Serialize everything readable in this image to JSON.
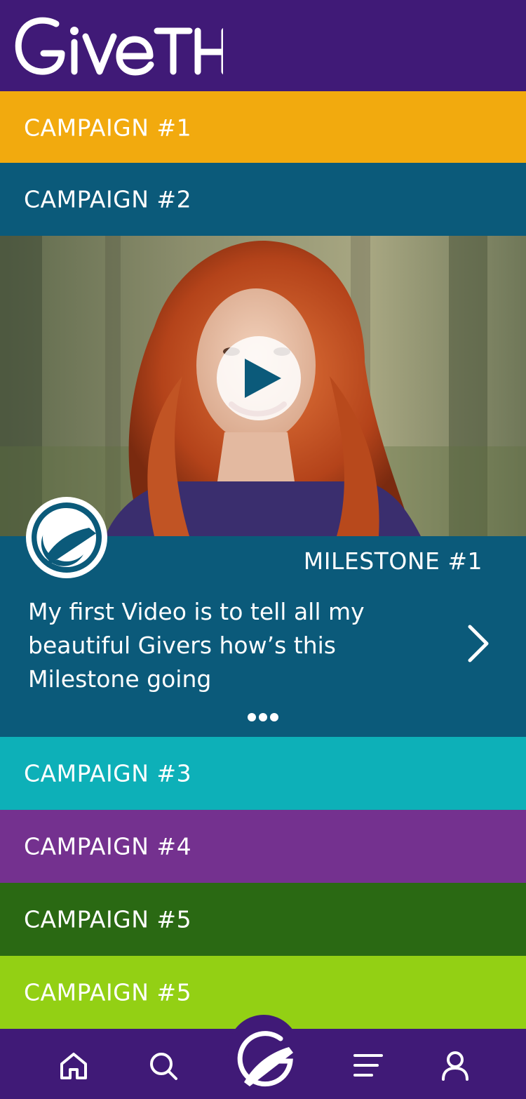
{
  "app": {
    "name": "GIVETH"
  },
  "colors": {
    "header": "#401a77",
    "campaign_1": "#f2aa0e",
    "campaign_2": "#0b5a7a",
    "campaign_3": "#0db0b8",
    "campaign_4": "#74318f",
    "campaign_5a": "#2a6913",
    "campaign_5b": "#93d014",
    "milestone_bg": "#0b5a7a"
  },
  "campaigns": [
    {
      "label": "CAMPAIGN #1"
    },
    {
      "label": "CAMPAIGN #2"
    },
    {
      "label": "CAMPAIGN #3"
    },
    {
      "label": "CAMPAIGN #4"
    },
    {
      "label": "CAMPAIGN #5"
    },
    {
      "label": "CAMPAIGN #5"
    }
  ],
  "milestone": {
    "title": "MILESTONE #1",
    "description": "My first Video is to tell all my beautiful Givers how’s this Milestone going",
    "badge_icon": "giveth-logo-icon",
    "more_icon": "more-dots-icon",
    "next_icon": "chevron-right-icon",
    "video_icon": "play-icon"
  },
  "bottom_nav": {
    "items": [
      {
        "icon": "home-icon"
      },
      {
        "icon": "search-icon"
      },
      {
        "icon": "giveth-logo-icon"
      },
      {
        "icon": "menu-icon"
      },
      {
        "icon": "profile-icon"
      }
    ]
  }
}
